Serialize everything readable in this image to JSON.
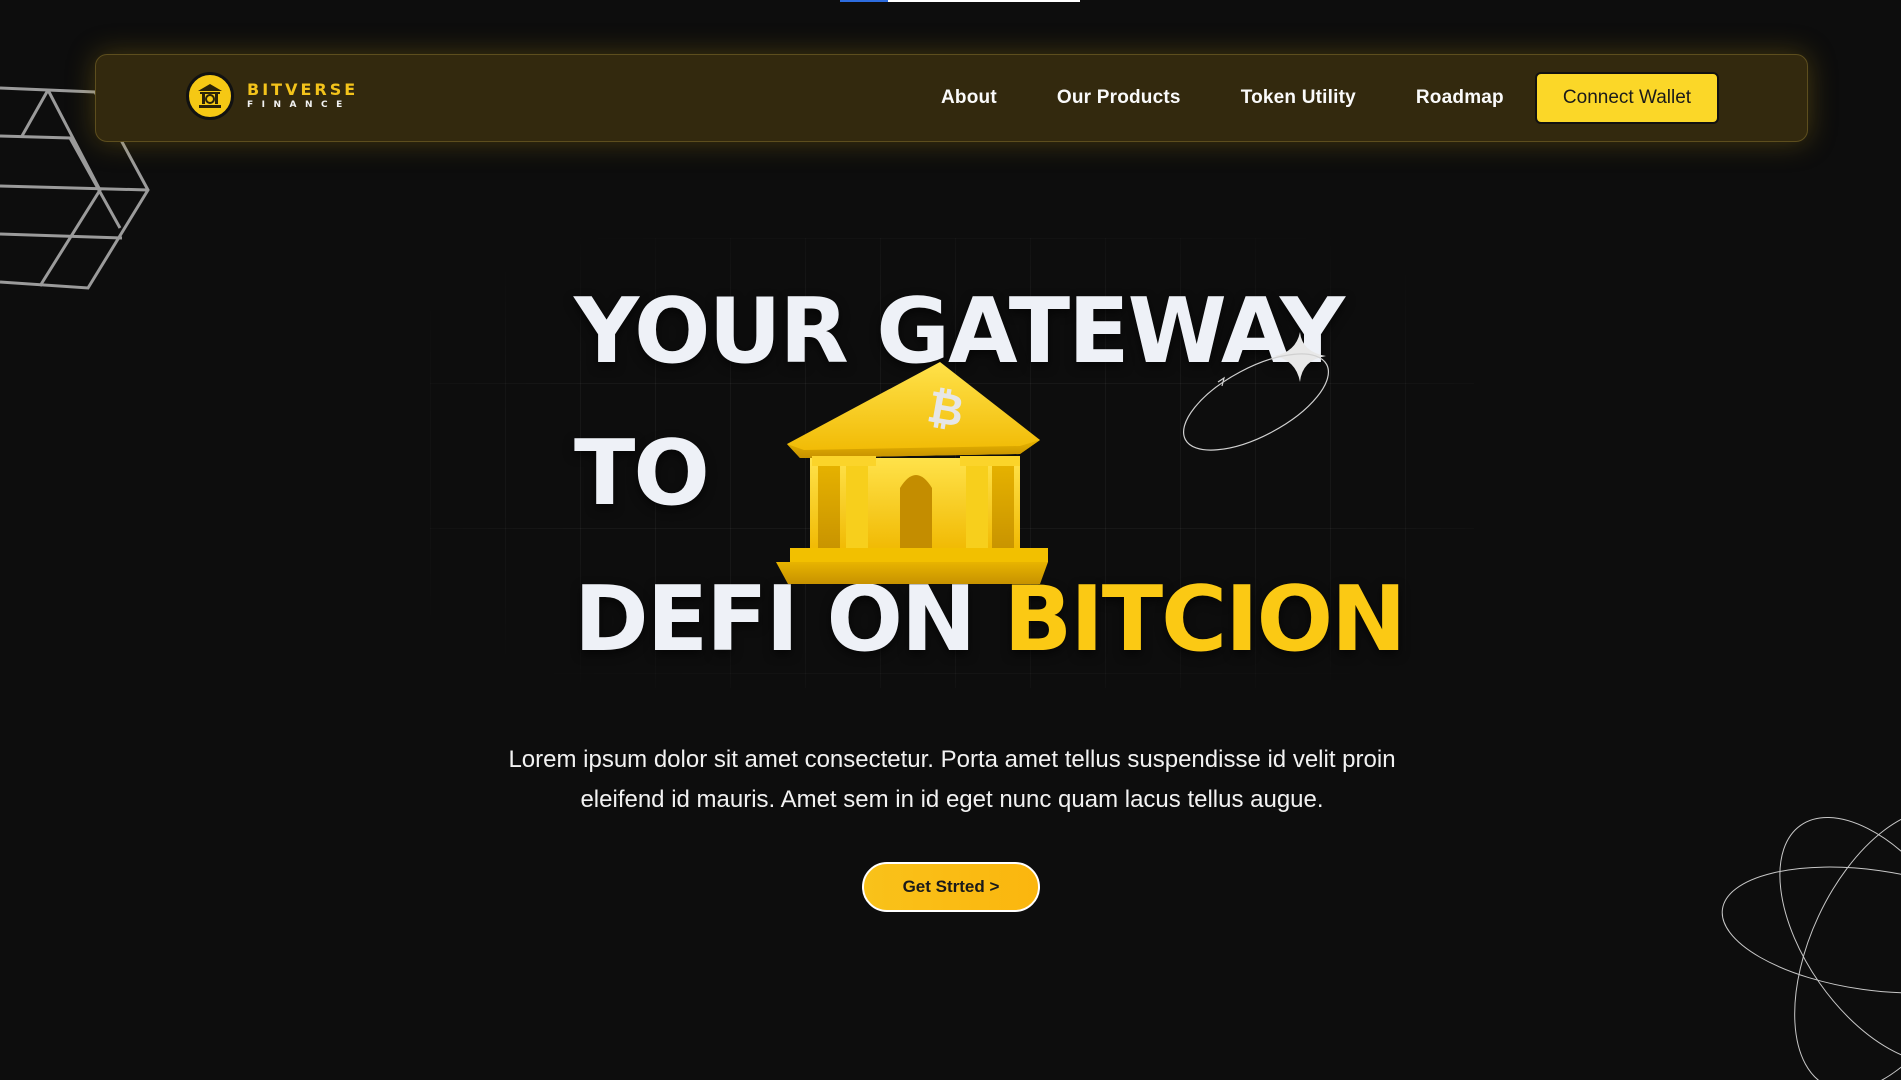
{
  "brand": {
    "name": "BITVERSE",
    "sub": "FINANCE",
    "logo_icon": "bank-icon"
  },
  "nav": {
    "items": [
      {
        "label": "About"
      },
      {
        "label": "Our Products"
      },
      {
        "label": "Token Utility"
      },
      {
        "label": "Roadmap"
      }
    ],
    "connect_label": "Connect Wallet"
  },
  "hero": {
    "line1": "YOUR GATEWAY",
    "line2": "TO",
    "line3_white": "DEFI ON ",
    "line3_accent": "BITCION",
    "illustration_icon": "bitcoin-bank-icon",
    "description_line1": "Lorem ipsum dolor sit amet consectetur. Porta amet tellus suspendisse id velit proin",
    "description_line2": "eleifend id mauris. Amet sem in id eget nunc quam lacus tellus augue.",
    "cta_label": "Get Strted >"
  },
  "colors": {
    "background": "#0d0d0d",
    "accent": "#fbc914",
    "navbar": "#33290e",
    "button_yellow": "#fbd728",
    "text": "#eef1f7"
  }
}
